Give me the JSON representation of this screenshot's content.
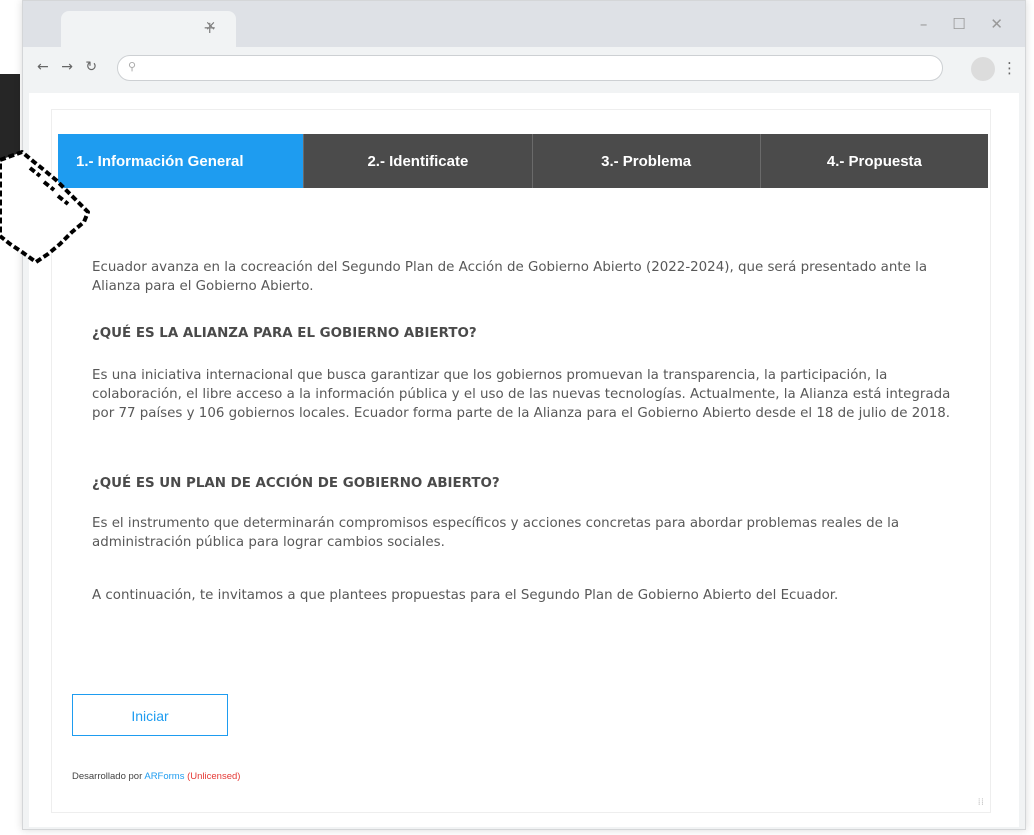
{
  "browser": {
    "tab_close": "×",
    "new_tab": "+",
    "controls": {
      "minimize": "–",
      "maximize": "☐",
      "close": "✕"
    },
    "nav": {
      "back": "←",
      "forward": "→",
      "reload": "↻"
    },
    "search_glyph": "⚲",
    "menu_glyph": "⋮"
  },
  "wizard": {
    "steps": [
      {
        "label": "1.- Información General",
        "active": true
      },
      {
        "label": "2.- Identificate",
        "active": false
      },
      {
        "label": "3.- Problema",
        "active": false
      },
      {
        "label": "4.- Propuesta",
        "active": false
      }
    ],
    "paragraph_1": "Ecuador avanza en la cocreación del Segundo Plan de Acción de Gobierno Abierto (2022-2024), que será presentado ante la Alianza para el Gobierno Abierto.",
    "heading_1": "¿QUÉ ES LA ALIANZA PARA EL GOBIERNO ABIERTO?",
    "paragraph_2": "Es una iniciativa internacional que busca garantizar que los gobiernos promuevan la transparencia, la participación, la colaboración, el libre acceso a la información pública y el uso de las nuevas tecnologías. Actualmente, la Alianza está integrada por 77 países y 106 gobiernos locales. Ecuador forma parte de la Alianza para el Gobierno Abierto desde el 18 de julio de 2018.",
    "heading_2": "¿QUÉ ES UN PLAN DE ACCIÓN DE GOBIERNO ABIERTO?",
    "paragraph_3": "Es el instrumento que determinarán compromisos específicos y acciones concretas para abordar problemas reales de la administración pública para lograr cambios sociales.",
    "paragraph_4": "A continuación, te invitamos a que plantees propuestas para el Segundo Plan de Gobierno Abierto del Ecuador.",
    "start_button": "Iniciar",
    "footer": {
      "prefix": "Desarrollado por ",
      "brand": "ARForms",
      "license": "(Unlicensed)"
    }
  },
  "colors": {
    "accent": "#1e9cf0",
    "step_bg": "#4b4b4b",
    "license": "#e53935"
  },
  "icons": [
    "hand-pointer-cursor-icon"
  ]
}
